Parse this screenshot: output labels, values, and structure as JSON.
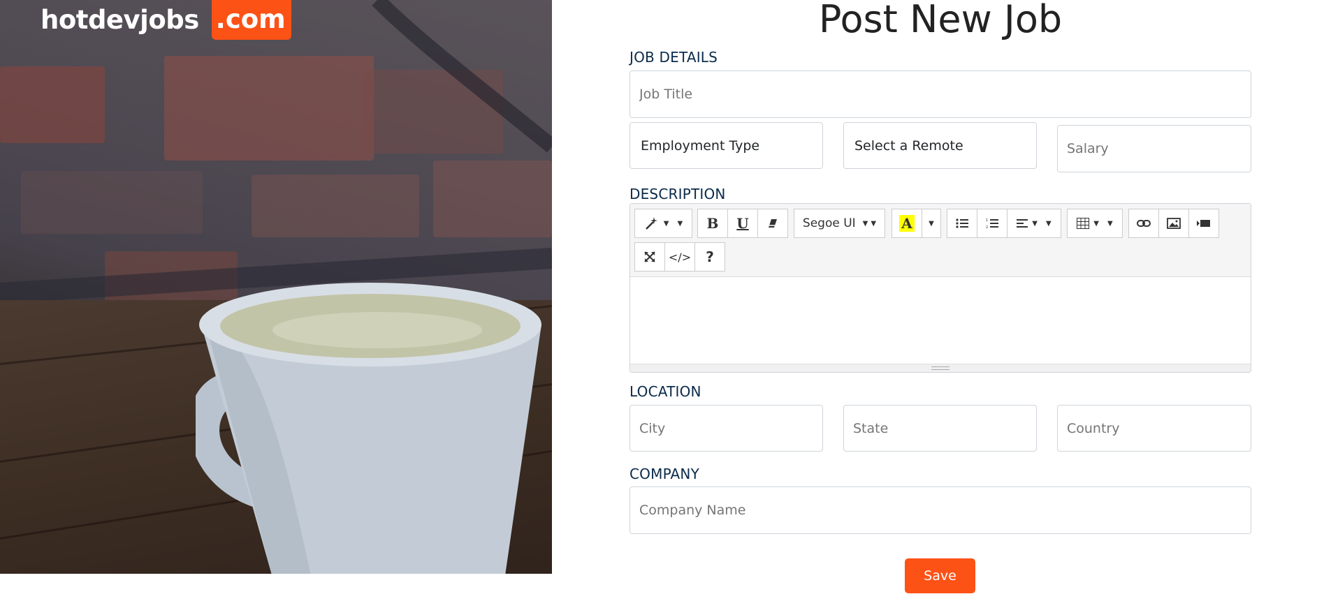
{
  "brand": {
    "name": "hotdevjobs",
    "tld": ".com",
    "accent": "#fc5216"
  },
  "page": {
    "title": "Post New Job"
  },
  "sections": {
    "job_details": "JOB DETAILS",
    "description": "DESCRIPTION",
    "location": "LOCATION",
    "company": "COMPANY"
  },
  "fields": {
    "job_title": {
      "placeholder": "Job Title",
      "value": ""
    },
    "employment_type": {
      "value": "Employment Type"
    },
    "remote": {
      "value": "Select a Remote"
    },
    "salary": {
      "placeholder": "Salary",
      "value": ""
    },
    "city": {
      "placeholder": "City",
      "value": ""
    },
    "state": {
      "placeholder": "State",
      "value": ""
    },
    "country": {
      "placeholder": "Country",
      "value": ""
    },
    "company_name": {
      "placeholder": "Company Name",
      "value": ""
    }
  },
  "editor": {
    "font_name": "Segoe UI",
    "toolbar": [
      "magic-wand",
      "bold",
      "underline",
      "eraser",
      "font-name",
      "highlight-color",
      "unordered-list",
      "ordered-list",
      "align",
      "table",
      "link",
      "picture",
      "video",
      "fullscreen",
      "code-view",
      "help"
    ],
    "labels": {
      "bold": "B",
      "underline": "U",
      "code": "</>",
      "help": "?",
      "highlight": "A"
    }
  },
  "actions": {
    "save": "Save"
  }
}
